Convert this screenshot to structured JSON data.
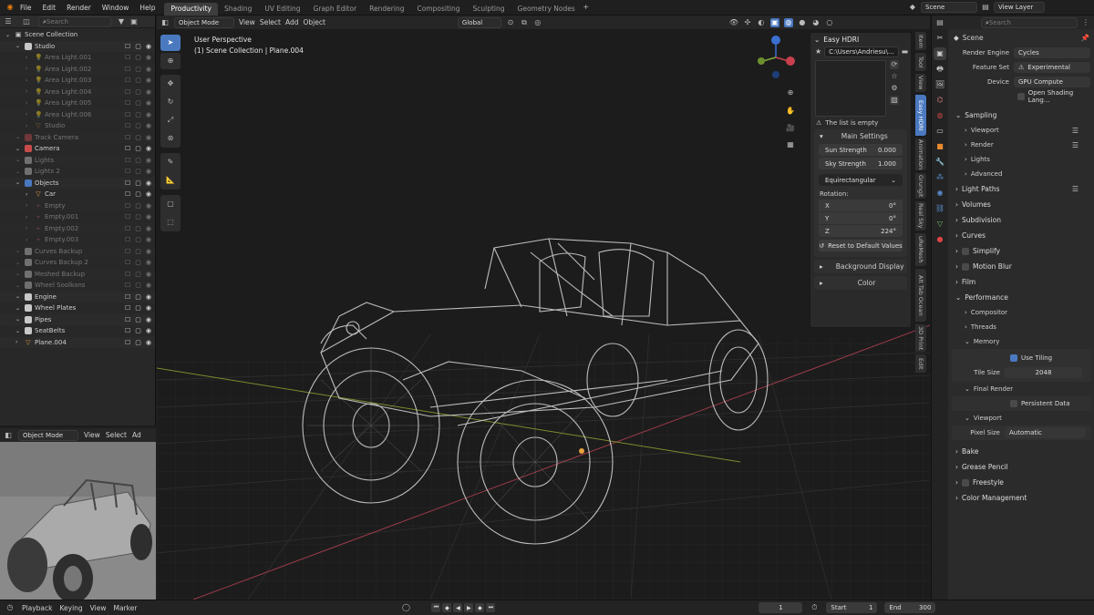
{
  "topbar": {
    "menus": [
      "File",
      "Edit",
      "Render",
      "Window",
      "Help"
    ],
    "workspaces": [
      "Productivity",
      "Shading",
      "UV Editing",
      "Graph Editor",
      "Rendering",
      "Compositing",
      "Sculpting",
      "Geometry Nodes"
    ],
    "active_workspace": "Productivity",
    "add_tab": "+",
    "scene": "Scene",
    "view_layer": "View Layer"
  },
  "outliner": {
    "search_placeholder": "Search",
    "rows": [
      {
        "name": "Scene Collection",
        "indent": 0,
        "type": "root",
        "dim": false,
        "icons": ""
      },
      {
        "name": "Studio",
        "indent": 1,
        "type": "collection",
        "color": "#c8c8c8",
        "dim": false,
        "icons": "☐ ▢ ◉"
      },
      {
        "name": "Area Light.001",
        "indent": 2,
        "type": "light",
        "dim": true,
        "icons": "☐ ▢ ◉"
      },
      {
        "name": "Area Light.002",
        "indent": 2,
        "type": "light",
        "dim": true,
        "icons": "☐ ▢ ◉"
      },
      {
        "name": "Area Light.003",
        "indent": 2,
        "type": "light",
        "dim": true,
        "icons": "☐ ▢ ◉"
      },
      {
        "name": "Area Light.004",
        "indent": 2,
        "type": "light",
        "dim": true,
        "icons": "☐ ▢ ◉"
      },
      {
        "name": "Area Light.005",
        "indent": 2,
        "type": "light",
        "dim": true,
        "icons": "☐ ▢ ◉"
      },
      {
        "name": "Area Light.006",
        "indent": 2,
        "type": "light",
        "dim": true,
        "icons": "☐ ▢ ◉"
      },
      {
        "name": "Studio",
        "indent": 2,
        "type": "mesh",
        "dim": true,
        "icons": "☐ ▢ ◉"
      },
      {
        "name": "Track Camera",
        "indent": 1,
        "type": "collection",
        "color": "#c84c4c",
        "dim": true,
        "icons": "☐ ▢ ◉"
      },
      {
        "name": "Camera",
        "indent": 1,
        "type": "collection",
        "color": "#c84c4c",
        "dim": false,
        "icons": "☐ ▢ ◉"
      },
      {
        "name": "Lights",
        "indent": 1,
        "type": "collection",
        "color": "#c8c8c8",
        "dim": true,
        "icons": "☐ ▢ ◉"
      },
      {
        "name": "Lights 2",
        "indent": 1,
        "type": "collection",
        "color": "#c8c8c8",
        "dim": true,
        "icons": "☐ ▢ ◉"
      },
      {
        "name": "Objects",
        "indent": 1,
        "type": "collection",
        "color": "#4a79c0",
        "dim": false,
        "icons": "☐ ▢ ◉"
      },
      {
        "name": "Car",
        "indent": 2,
        "type": "mesh",
        "dim": false,
        "icons": "☐ ▢ ◉"
      },
      {
        "name": "Empty",
        "indent": 2,
        "type": "empty",
        "dim": true,
        "icons": "☐ ▢ ◉"
      },
      {
        "name": "Empty.001",
        "indent": 2,
        "type": "empty",
        "dim": true,
        "icons": "☐ ▢ ◉"
      },
      {
        "name": "Empty.002",
        "indent": 2,
        "type": "empty",
        "dim": true,
        "icons": "☐ ▢ ◉"
      },
      {
        "name": "Empty.003",
        "indent": 2,
        "type": "empty",
        "dim": true,
        "icons": "☐ ▢ ◉"
      },
      {
        "name": "Curves Backup",
        "indent": 1,
        "type": "collection",
        "color": "#c8c8c8",
        "dim": true,
        "icons": "☐ ▢ ◉"
      },
      {
        "name": "Curves Backup 2",
        "indent": 1,
        "type": "collection",
        "color": "#c8c8c8",
        "dim": true,
        "icons": "☐ ▢ ◉"
      },
      {
        "name": "Meshed Backup",
        "indent": 1,
        "type": "collection",
        "color": "#c8c8c8",
        "dim": true,
        "icons": "☐ ▢ ◉"
      },
      {
        "name": "Wheel Soolkans",
        "indent": 1,
        "type": "collection",
        "color": "#c8c8c8",
        "dim": true,
        "icons": "☐ ▢ ◉"
      },
      {
        "name": "Engine",
        "indent": 1,
        "type": "collection",
        "color": "#c8c8c8",
        "dim": false,
        "icons": "☐ ▢ ◉"
      },
      {
        "name": "Wheel Plates",
        "indent": 1,
        "type": "collection",
        "color": "#c8c8c8",
        "dim": false,
        "icons": "☐ ▢ ◉"
      },
      {
        "name": "Pipes",
        "indent": 1,
        "type": "collection",
        "color": "#c8c8c8",
        "dim": false,
        "icons": "☐ ▢ ◉"
      },
      {
        "name": "SeatBelts",
        "indent": 1,
        "type": "collection",
        "color": "#c8c8c8",
        "dim": false,
        "icons": "☐ ▢ ◉"
      },
      {
        "name": "Plane.004",
        "indent": 1,
        "type": "mesh",
        "dim": false,
        "icons": "☐ ▢ ◉"
      }
    ]
  },
  "preview": {
    "mode": "Object Mode",
    "menus": [
      "View",
      "Select",
      "Ad"
    ]
  },
  "viewport": {
    "mode": "Object Mode",
    "menus": [
      "View",
      "Select",
      "Add",
      "Object"
    ],
    "transform": "Global",
    "title": "User Perspective",
    "subtitle": "(1) Scene Collection | Plane.004"
  },
  "hdri": {
    "title": "Easy HDRI",
    "path": "C:\\Users\\Andriesu\\...",
    "empty_msg": "The list is empty",
    "main_settings": "Main Settings",
    "sun_strength_label": "Sun Strength",
    "sun_strength": "0.000",
    "sky_strength_label": "Sky Strength",
    "sky_strength": "1.000",
    "projection": "Equirectangular",
    "rotation_label": "Rotation:",
    "rot_x_label": "X",
    "rot_x": "0°",
    "rot_y_label": "Y",
    "rot_y": "0°",
    "rot_z_label": "Z",
    "rot_z": "224°",
    "reset_label": "Reset to Default Values",
    "bg_display": "Background Display",
    "color": "Color"
  },
  "vtabs": [
    {
      "label": "Item",
      "active": false
    },
    {
      "label": "Tool",
      "active": false
    },
    {
      "label": "View",
      "active": false
    },
    {
      "label": "Easy HDRI",
      "active": true
    },
    {
      "label": "Animation",
      "active": false
    },
    {
      "label": "Grungit",
      "active": false
    },
    {
      "label": "Real Sky",
      "active": false
    },
    {
      "label": "uReMesh",
      "active": false
    },
    {
      "label": "Alt Tab Ocean",
      "active": false
    },
    {
      "label": "3D Print",
      "active": false
    },
    {
      "label": "Edit",
      "active": false
    }
  ],
  "properties": {
    "search_placeholder": "Search",
    "scene": "Scene",
    "render_engine_label": "Render Engine",
    "render_engine": "Cycles",
    "feature_set_label": "Feature Set",
    "feature_set": "Experimental",
    "device_label": "Device",
    "device": "GPU Compute",
    "osl_label": "Open Shading Lang...",
    "sections": {
      "sampling": "Sampling",
      "viewport": "Viewport",
      "render": "Render",
      "lights": "Lights",
      "advanced": "Advanced",
      "light_paths": "Light Paths",
      "volumes": "Volumes",
      "subdivision": "Subdivision",
      "curves": "Curves",
      "simplify": "Simplify",
      "motion_blur": "Motion Blur",
      "film": "Film",
      "performance": "Performance",
      "compositor": "Compositor",
      "threads": "Threads",
      "memory": "Memory",
      "use_tiling": "Use Tiling",
      "tile_size_label": "Tile Size",
      "tile_size": "2048",
      "final_render": "Final Render",
      "persistent_data": "Persistent Data",
      "viewport2": "Viewport",
      "pixel_size_label": "Pixel Size",
      "pixel_size": "Automatic",
      "bake": "Bake",
      "grease_pencil": "Grease Pencil",
      "freestyle": "Freestyle",
      "color_management": "Color Management"
    }
  },
  "timeline": {
    "menus": [
      "Playback",
      "Keying",
      "View",
      "Marker"
    ],
    "current_frame": "1",
    "start_label": "Start",
    "start": "1",
    "end_label": "End",
    "end": "300"
  }
}
